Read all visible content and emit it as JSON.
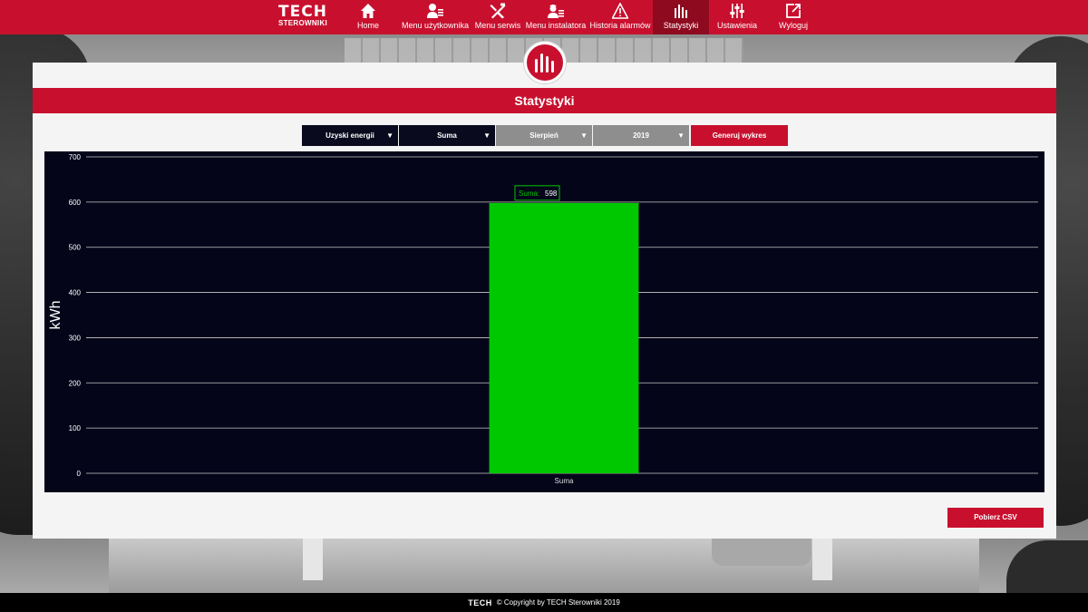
{
  "brand": {
    "line1": "TECH",
    "line2": "STEROWNIKI"
  },
  "nav": [
    {
      "label": "Home",
      "icon": "home-icon"
    },
    {
      "label": "Menu użytkownika",
      "icon": "user-menu-icon"
    },
    {
      "label": "Menu serwis",
      "icon": "tools-icon"
    },
    {
      "label": "Menu instalatora",
      "icon": "installer-icon"
    },
    {
      "label": "Historia alarmów",
      "icon": "alarm-warning-icon"
    },
    {
      "label": "Statystyki",
      "icon": "bar-chart-icon",
      "active": true
    },
    {
      "label": "Ustawienia",
      "icon": "sliders-icon"
    },
    {
      "label": "Wyloguj",
      "icon": "logout-icon"
    }
  ],
  "page": {
    "title": "Statystyki",
    "badge_icon": "bar-chart-icon"
  },
  "filters": {
    "type": "Uzyski energii",
    "mode": "Suma",
    "month": "Sierpień",
    "year": "2019",
    "generate_label": "Generuj wykres"
  },
  "chart_data": {
    "type": "bar",
    "categories": [
      "Suma"
    ],
    "values": [
      598
    ],
    "ylabel": "kWh",
    "ylim": [
      0,
      700
    ],
    "yticks": [
      0,
      100,
      200,
      300,
      400,
      500,
      600,
      700
    ],
    "grid": true,
    "bar_color": "#00c800",
    "annotation": {
      "label": "Suma:",
      "value": "598"
    }
  },
  "actions": {
    "csv_label": "Pobierz CSV"
  },
  "footer": {
    "logo": "TECH",
    "text": "© Copyright by TECH Sterowniki 2019"
  },
  "colors": {
    "accent": "#c8102e",
    "active_nav": "#8e0a1f",
    "chart_bg": "#05051a"
  }
}
